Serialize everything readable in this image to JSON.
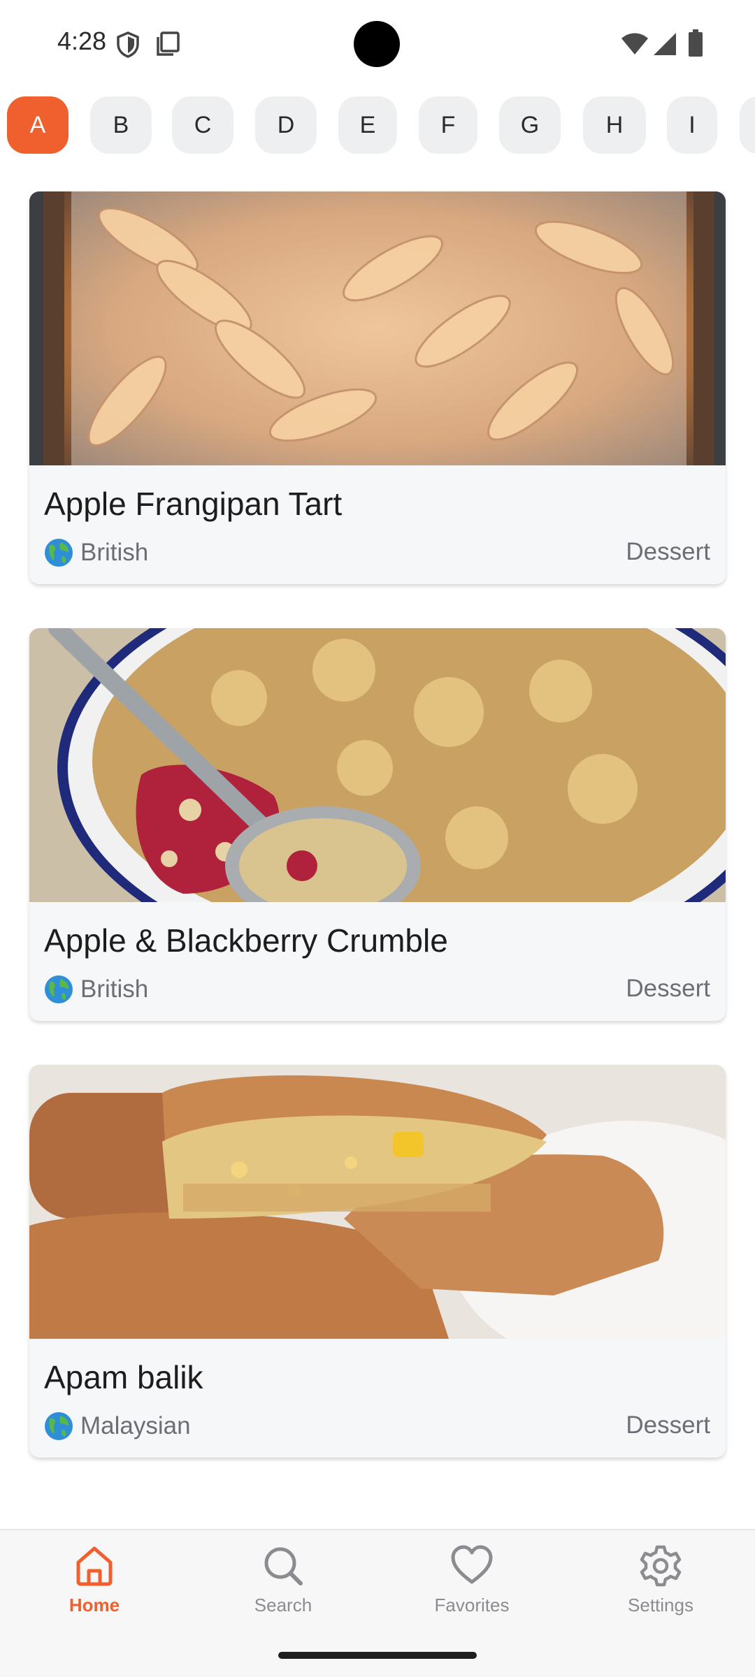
{
  "status_bar": {
    "time": "4:28"
  },
  "letters": [
    "A",
    "B",
    "C",
    "D",
    "E",
    "F",
    "G",
    "H",
    "I"
  ],
  "active_letter": "A",
  "meals": [
    {
      "title": "Apple Frangipan Tart",
      "area": "British",
      "category": "Dessert"
    },
    {
      "title": "Apple & Blackberry Crumble",
      "area": "British",
      "category": "Dessert"
    },
    {
      "title": "Apam balik",
      "area": "Malaysian",
      "category": "Dessert"
    }
  ],
  "nav": {
    "home": "Home",
    "search": "Search",
    "favorites": "Favorites",
    "settings": "Settings"
  },
  "colors": {
    "accent": "#f0602f",
    "chip_bg": "#eeeff1",
    "card_bg": "#f6f7f9",
    "muted_text": "#6b6e74"
  },
  "icons": {
    "area": "globe-icon",
    "nav_home": "home-icon",
    "nav_search": "search-icon",
    "nav_favorites": "heart-icon",
    "nav_settings": "gear-icon"
  }
}
